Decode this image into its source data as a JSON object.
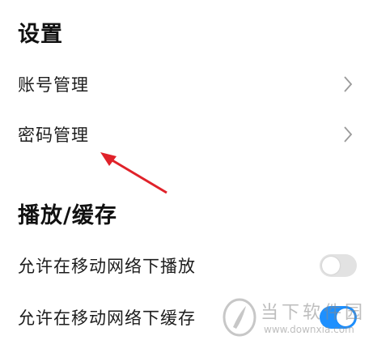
{
  "settings": {
    "section_title": "设置",
    "items": [
      {
        "label": "账号管理"
      },
      {
        "label": "密码管理"
      }
    ]
  },
  "playback": {
    "section_title": "播放/缓存",
    "toggles": [
      {
        "label": "允许在移动网络下播放",
        "enabled": false
      },
      {
        "label": "允许在移动网络下缓存",
        "enabled": true
      }
    ]
  },
  "watermark": {
    "name": "当下软件园",
    "url": "www.downxia.com"
  },
  "colors": {
    "toggle_on": "#1e90ff",
    "toggle_off": "#e2e2e2",
    "annotation_arrow": "#e0222a"
  }
}
